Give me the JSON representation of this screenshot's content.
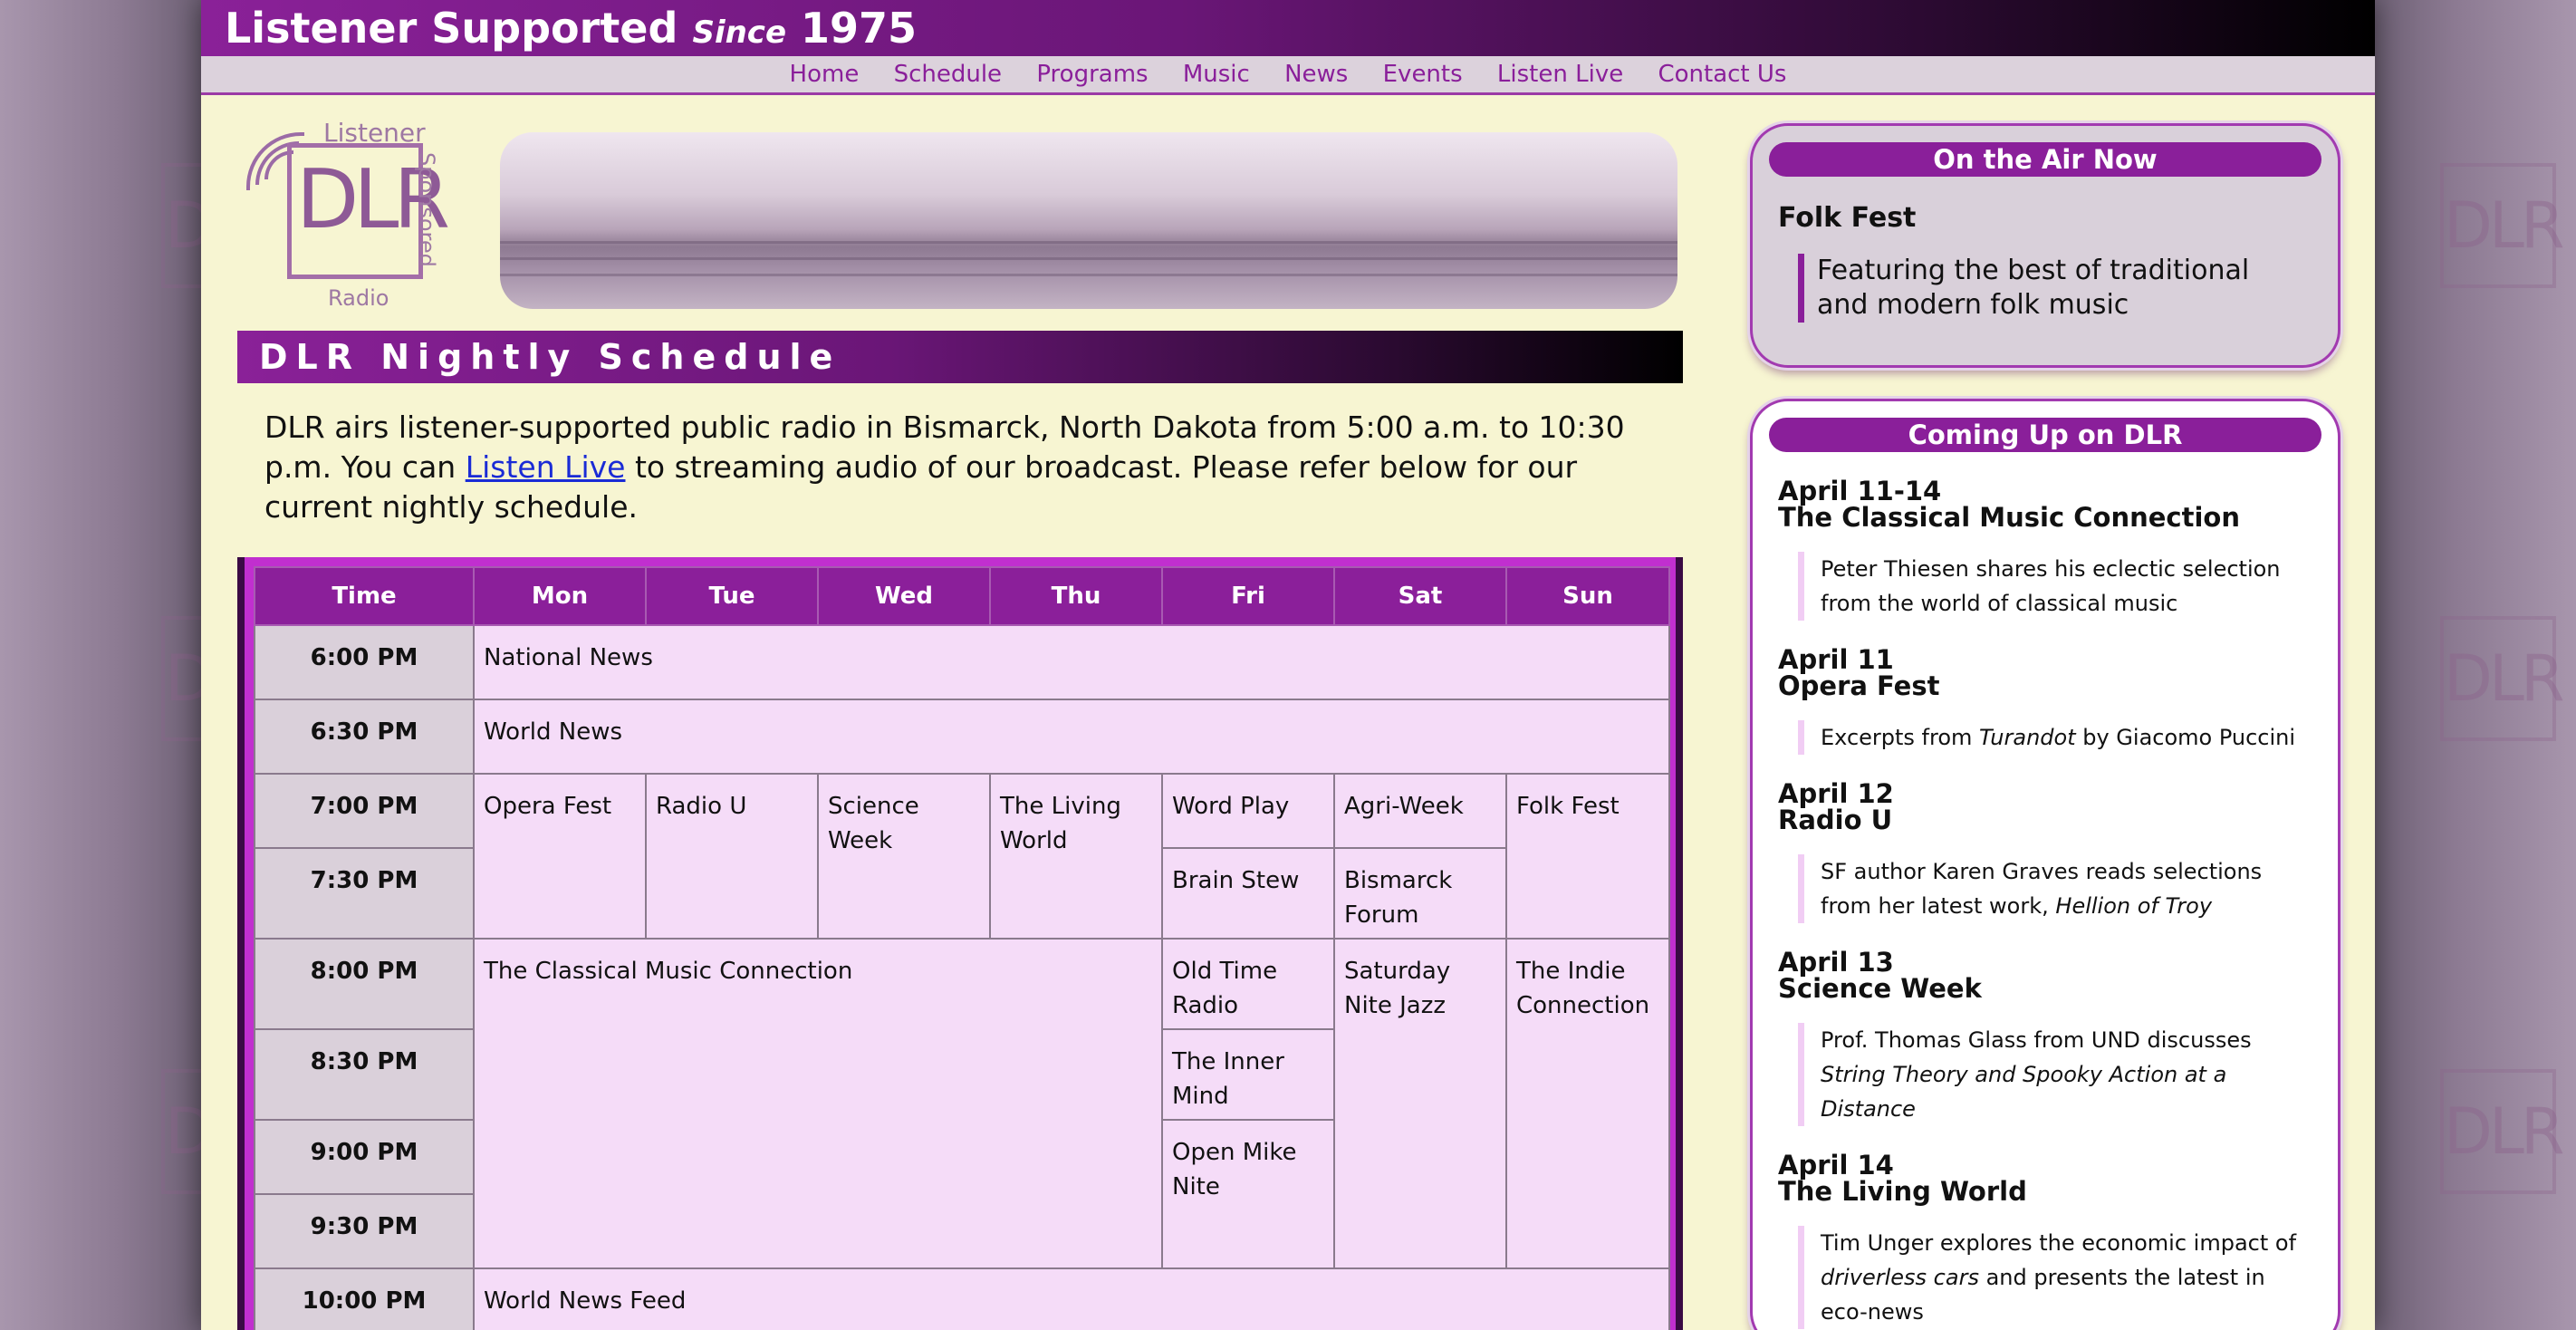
{
  "banner": {
    "prefix": "Listener Supported",
    "since": "Since",
    "year": "1975"
  },
  "nav": [
    "Home",
    "Schedule",
    "Programs",
    "Music",
    "News",
    "Events",
    "Listen Live",
    "Contact Us"
  ],
  "logo": {
    "top_text": "Listener",
    "letters": "DLR",
    "bottom_text": "Radio",
    "side_text": "Sponsored"
  },
  "watermark": "DLR",
  "schedule_heading": "DLR Nightly Schedule",
  "intro": {
    "before_link": "DLR airs listener-supported public radio in Bismarck, North Dakota from 5:00 a.m. to 10:30 p.m. You can ",
    "link": "Listen Live",
    "after_link": " to streaming audio of our broadcast. Please refer below for our current nightly schedule."
  },
  "table": {
    "headers": [
      "Time",
      "Mon",
      "Tue",
      "Wed",
      "Thu",
      "Fri",
      "Sat",
      "Sun"
    ],
    "times": [
      "6:00 PM",
      "6:30 PM",
      "7:00 PM",
      "7:30 PM",
      "8:00 PM",
      "8:30 PM",
      "9:00 PM",
      "9:30 PM",
      "10:00 PM"
    ],
    "programs": {
      "national_news": "National News",
      "world_news": "World News",
      "opera_fest": "Opera Fest",
      "radio_u": "Radio U",
      "science_week": "Science Week",
      "living_world": "The Living World",
      "word_play": "Word Play",
      "agri_week": "Agri-Week",
      "folk_fest": "Folk Fest",
      "brain_stew": "Brain Stew",
      "bismarck_forum": "Bismarck Forum",
      "classical": "The Classical Music Connection",
      "old_time_radio": "Old Time Radio",
      "saturday_jazz": "Saturday Nite Jazz",
      "indie": "The Indie Connection",
      "inner_mind": "The Inner Mind",
      "open_mike": "Open Mike Nite",
      "world_news_feed": "World News Feed"
    }
  },
  "on_air": {
    "title": "On the Air Now",
    "show": "Folk Fest",
    "description": "Featuring the best of traditional and modern folk music"
  },
  "coming_up": {
    "title": "Coming Up on DLR",
    "events": [
      {
        "date": "April 11-14",
        "title": "The Classical Music Connection",
        "desc": "Peter Thiesen shares his eclectic selection from the world of classical music"
      },
      {
        "date": "April 11",
        "title": "Opera Fest",
        "desc_pre": "Excerpts from ",
        "desc_em": "Turandot",
        "desc_post": " by Giacomo Puccini"
      },
      {
        "date": "April 12",
        "title": "Radio U",
        "desc_pre": "SF author Karen Graves reads selections from her latest work, ",
        "desc_em": "Hellion of Troy",
        "desc_post": ""
      },
      {
        "date": "April 13",
        "title": "Science Week",
        "desc_pre": "Prof. Thomas Glass from UND discusses ",
        "desc_em": "String Theory and Spooky Action at a Distance",
        "desc_post": ""
      },
      {
        "date": "April 14",
        "title": "The Living World",
        "desc_pre": "Tim Unger explores the economic impact of ",
        "desc_em": "driverless cars",
        "desc_post": " and presents the latest in eco-news"
      }
    ]
  },
  "colors": {
    "accent": "#8a1f9a",
    "page_bg": "#f7f5d2",
    "cell_bg": "#f5dcf8",
    "time_bg": "#dad0da",
    "link": "#1a2bd6"
  }
}
